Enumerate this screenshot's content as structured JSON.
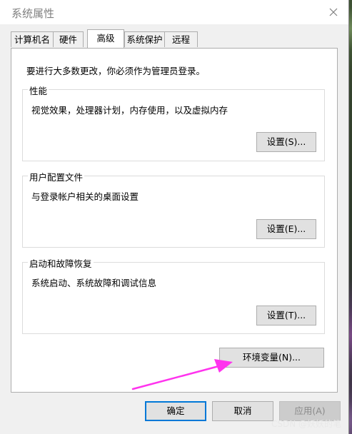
{
  "window": {
    "title": "系统属性"
  },
  "tabs": [
    {
      "label": "计算机名",
      "active": false
    },
    {
      "label": "硬件",
      "active": false
    },
    {
      "label": "高级",
      "active": true
    },
    {
      "label": "系统保护",
      "active": false
    },
    {
      "label": "远程",
      "active": false
    }
  ],
  "advanced": {
    "admin_note": "要进行大多数更改，你必须作为管理员登录。",
    "performance": {
      "title": "性能",
      "description": "视觉效果，处理器计划，内存使用，以及虚拟内存",
      "button": "设置(S)..."
    },
    "user_profiles": {
      "title": "用户配置文件",
      "description": "与登录帐户相关的桌面设置",
      "button": "设置(E)..."
    },
    "startup_recovery": {
      "title": "启动和故障恢复",
      "description": "系统启动、系统故障和调试信息",
      "button": "设置(T)..."
    },
    "env_button": "环境变量(N)..."
  },
  "footer": {
    "ok": "确定",
    "cancel": "取消",
    "apply": "应用(A)"
  },
  "annotation": {
    "arrow_color": "#ff33ee"
  },
  "watermark": "CSDN @妖妖的笔",
  "icons": {
    "close": "close-icon"
  }
}
